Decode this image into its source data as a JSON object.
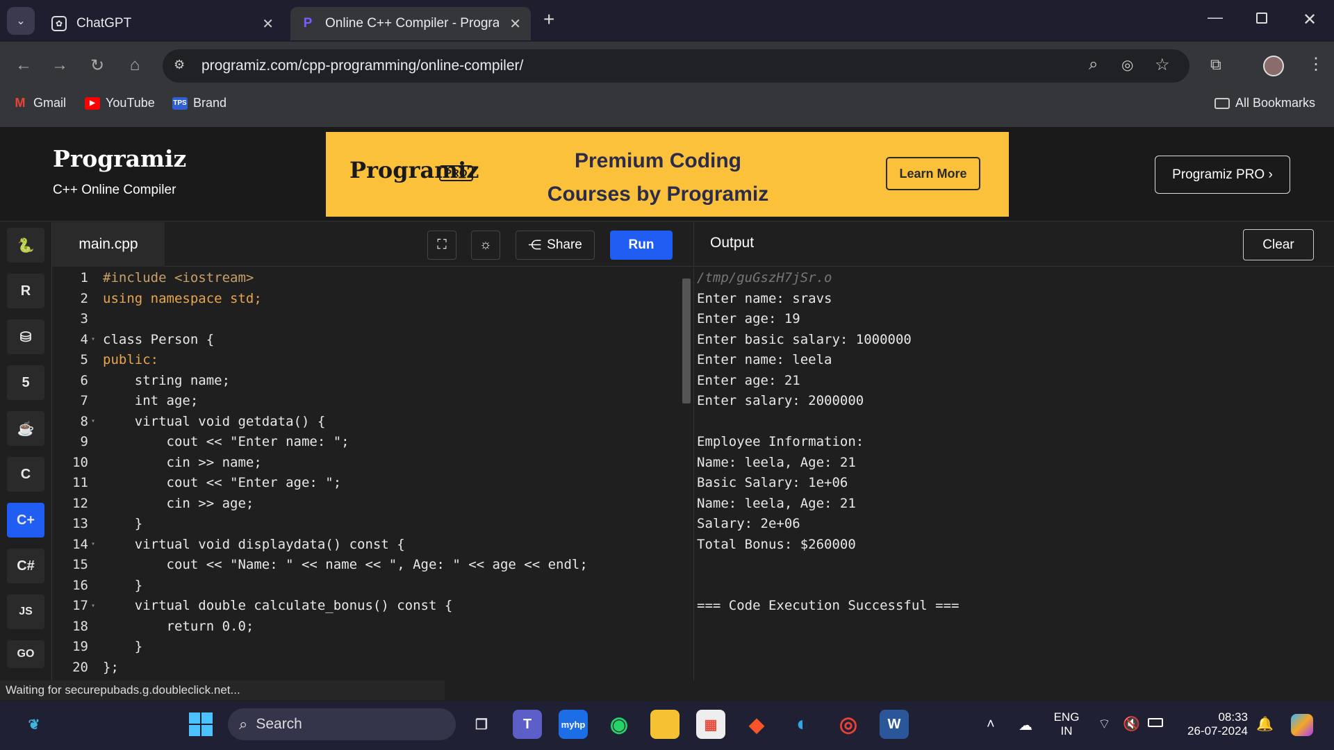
{
  "browser": {
    "tabs": [
      {
        "title": "ChatGPT",
        "icon": "chatgpt-icon"
      },
      {
        "title": "Online C++ Compiler - Program",
        "icon": "programiz-icon"
      }
    ],
    "url": "programiz.com/cpp-programming/online-compiler/",
    "bookmarks": [
      "Gmail",
      "YouTube",
      "Brand"
    ],
    "all_bookmarks": "All Bookmarks"
  },
  "header": {
    "logo": "Programiz",
    "subtitle": "C++ Online Compiler",
    "banner": {
      "logo": "Programiz",
      "pro_badge": "PRO",
      "line1": "Premium Coding",
      "line2": "Courses by Programiz",
      "button": "Learn More"
    },
    "pro_button": "Programiz PRO ›"
  },
  "editor": {
    "filename": "main.cpp",
    "share_label": "Share",
    "run_label": "Run",
    "lines": [
      "#include <iostream>",
      "using namespace std;",
      "",
      "class Person {",
      "public:",
      "    string name;",
      "    int age;",
      "    virtual void getdata() {",
      "        cout << \"Enter name: \";",
      "        cin >> name;",
      "        cout << \"Enter age: \";",
      "        cin >> age;",
      "    }",
      "    virtual void displaydata() const {",
      "        cout << \"Name: \" << name << \", Age: \" << age << endl;",
      "    }",
      "    virtual double calculate_bonus() const {",
      "        return 0.0;",
      "    }",
      "};"
    ]
  },
  "output": {
    "label": "Output",
    "clear_label": "Clear",
    "lines": [
      "/tmp/guGszH7jSr.o",
      "Enter name: sravs",
      "Enter age: 19",
      "Enter basic salary: 1000000",
      "Enter name: leela",
      "Enter age: 21",
      "Enter salary: 2000000",
      "",
      "Employee Information:",
      "Name: leela, Age: 21",
      "Basic Salary: 1e+06",
      "Name: leela, Age: 21",
      "Salary: 2e+06",
      "Total Bonus: $260000",
      "",
      "",
      "=== Code Execution Successful ==="
    ]
  },
  "status": "Waiting for securepubads.g.doubleclick.net...",
  "taskbar": {
    "search": "Search",
    "lang1": "ENG",
    "lang2": "IN",
    "time": "08:33",
    "date": "26-07-2024"
  }
}
